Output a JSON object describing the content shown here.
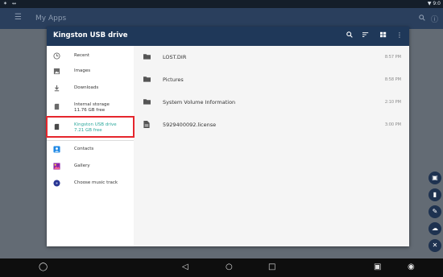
{
  "status_bar": {
    "left_icons": "✶ ↔",
    "right": "▼ 9:0"
  },
  "app_bar": {
    "title": "My Apps",
    "menu_icon": "menu-icon",
    "search_icon": "search-icon",
    "info_icon": "info-icon"
  },
  "dialog": {
    "title": "Kingston USB drive",
    "actions": [
      "search-icon",
      "sort-icon",
      "grid-view-icon",
      "more-icon"
    ]
  },
  "drawer": {
    "items": [
      {
        "label": "Recent",
        "icon": "clock-icon"
      },
      {
        "label": "Images",
        "icon": "image-icon"
      },
      {
        "label": "Downloads",
        "icon": "download-icon"
      },
      {
        "label": "Internal storage",
        "sub": "11.76 GB free",
        "icon": "phone-storage-icon"
      },
      {
        "label": "Kingston USB drive",
        "sub": "7.21 GB free",
        "icon": "sd-card-icon"
      },
      {
        "label": "Contacts",
        "icon": "contacts-icon"
      },
      {
        "label": "Gallery",
        "icon": "gallery-icon"
      },
      {
        "label": "Choose music track",
        "icon": "music-icon"
      }
    ]
  },
  "files": [
    {
      "name": "LOST.DIR",
      "time": "8:57 PM",
      "icon": "folder-icon"
    },
    {
      "name": "Pictures",
      "time": "8:58 PM",
      "icon": "folder-icon"
    },
    {
      "name": "System Volume Information",
      "time": "2:10 PM",
      "icon": "folder-icon"
    },
    {
      "name": "5929400092.license",
      "time": "3:00 PM",
      "icon": "file-icon"
    }
  ],
  "colors": {
    "app_bar": "#2a3f5d",
    "dialog_bar": "#1f3859",
    "active_text": "#2aa79b",
    "highlight": "#e5262d"
  }
}
